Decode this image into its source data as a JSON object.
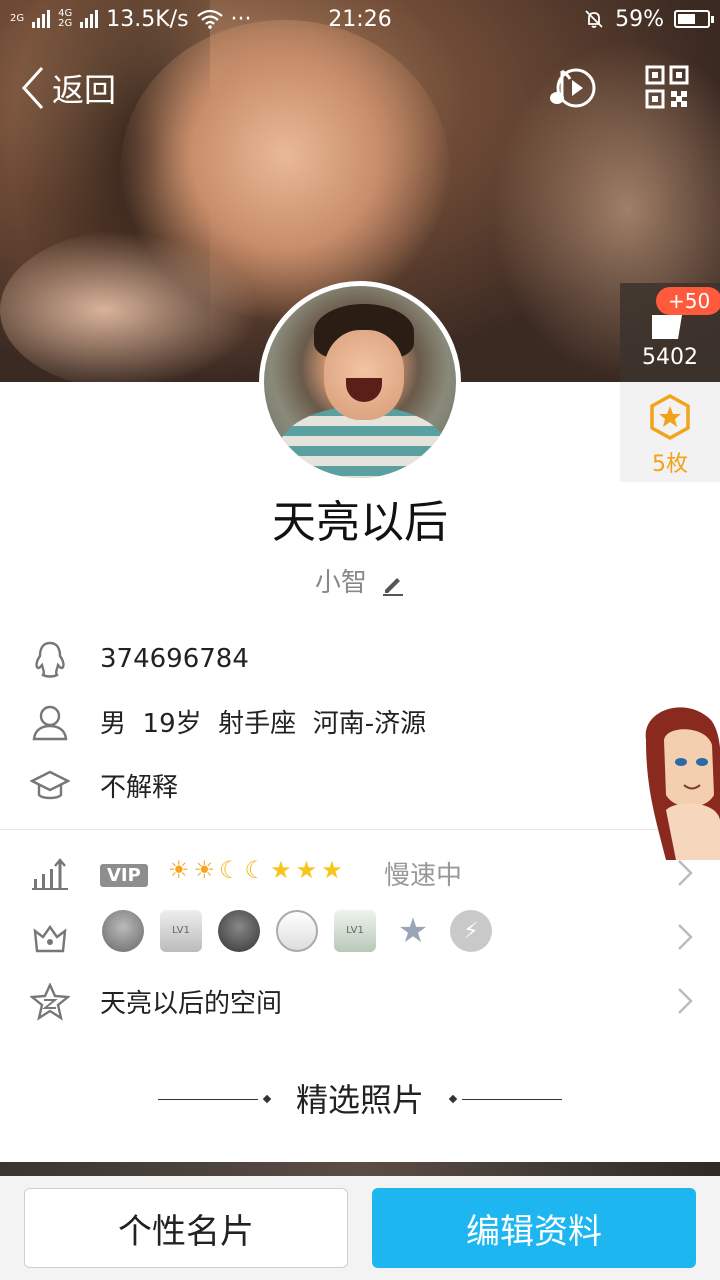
{
  "status_bar": {
    "network_1": "2G",
    "network_2": "4G",
    "network_3": "2G",
    "speed": "13.5K/s",
    "more": "···",
    "time": "21:26",
    "battery": "59%",
    "battery_level": 0.59
  },
  "nav": {
    "back_label": "返回",
    "music_icon": "music-play-icon",
    "qr_icon": "qr-code-icon"
  },
  "side_panel": {
    "like_badge": "+50",
    "like_count": "5402",
    "coin_count": "5枚"
  },
  "profile": {
    "name": "天亮以后",
    "nickname": "小智",
    "qq_number": "374696784",
    "gender": "男",
    "age": "19岁",
    "zodiac": "射手座",
    "location": "河南-济源",
    "personal_info": "不解释"
  },
  "level": {
    "vip_label": "VIP",
    "speed_status": "慢速中",
    "icons": [
      "sun",
      "sun",
      "moon",
      "moon",
      "star",
      "star",
      "star"
    ]
  },
  "badges": {
    "tiny_label_1": "LV1",
    "tiny_label_2": "LV1"
  },
  "space": {
    "label": "天亮以后的空间"
  },
  "section": {
    "title": "精选照片"
  },
  "buttons": {
    "card_label": "个性名片",
    "edit_label": "编辑资料"
  },
  "colors": {
    "accent": "#1eb6f0",
    "badge_red": "#ff5a3c",
    "coin_gold": "#f3a31b"
  }
}
